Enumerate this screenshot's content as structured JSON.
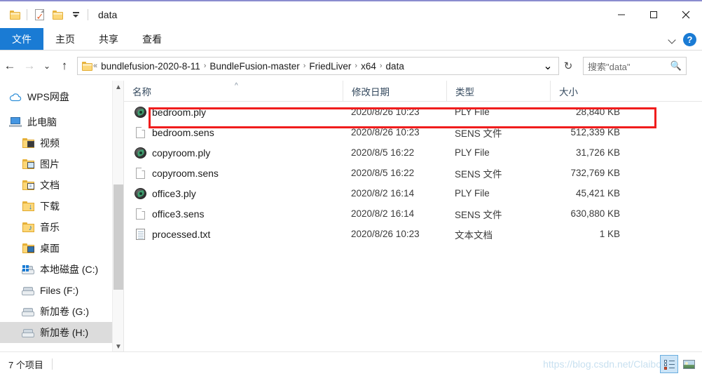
{
  "window": {
    "title": "data",
    "quick_access": [
      {
        "name": "folder-icon",
        "label": "folder"
      },
      {
        "name": "properties-icon",
        "label": "properties"
      },
      {
        "name": "new-folder-icon",
        "label": "new folder"
      },
      {
        "name": "customize-caret-icon",
        "label": "customize"
      }
    ],
    "controls": {
      "minimize": "minimize",
      "maximize": "maximize",
      "close": "close"
    }
  },
  "ribbon": {
    "tabs": [
      {
        "label": "文件",
        "active": true
      },
      {
        "label": "主页",
        "active": false
      },
      {
        "label": "共享",
        "active": false
      },
      {
        "label": "查看",
        "active": false
      }
    ],
    "expand_label": "chevron-down",
    "help_label": "?"
  },
  "addressbar": {
    "back": "←",
    "forward": "→",
    "recent": "⌄",
    "up": "↑",
    "overflow": "«",
    "crumbs": [
      "bundlefusion-2020-8-11",
      "BundleFusion-master",
      "FriedLiver",
      "x64",
      "data"
    ],
    "separator": "›",
    "dropdown": "⌄",
    "refresh": "↻"
  },
  "search": {
    "placeholder": "搜索\"data\"",
    "icon": "search-icon"
  },
  "sidebar": {
    "items": [
      {
        "label": "WPS网盘",
        "icon": "cloud-icon",
        "indent": 0,
        "selected": false
      },
      {
        "label": "此电脑",
        "icon": "this-pc-icon",
        "indent": 0,
        "selected": false
      },
      {
        "label": "视频",
        "icon": "videos-folder-icon",
        "indent": 1,
        "selected": false
      },
      {
        "label": "图片",
        "icon": "pictures-folder-icon",
        "indent": 1,
        "selected": false
      },
      {
        "label": "文档",
        "icon": "documents-folder-icon",
        "indent": 1,
        "selected": false
      },
      {
        "label": "下载",
        "icon": "downloads-folder-icon",
        "indent": 1,
        "selected": false
      },
      {
        "label": "音乐",
        "icon": "music-folder-icon",
        "indent": 1,
        "selected": false
      },
      {
        "label": "桌面",
        "icon": "desktop-folder-icon",
        "indent": 1,
        "selected": false
      },
      {
        "label": "本地磁盘 (C:)",
        "icon": "system-drive-icon",
        "indent": 1,
        "selected": false
      },
      {
        "label": "Files (F:)",
        "icon": "drive-icon",
        "indent": 1,
        "selected": false
      },
      {
        "label": "新加卷 (G:)",
        "icon": "drive-icon",
        "indent": 1,
        "selected": false
      },
      {
        "label": "新加卷 (H:)",
        "icon": "drive-icon",
        "indent": 1,
        "selected": true
      }
    ]
  },
  "filelist": {
    "columns": [
      {
        "label": "名称",
        "key": "name"
      },
      {
        "label": "修改日期",
        "key": "date"
      },
      {
        "label": "类型",
        "key": "type"
      },
      {
        "label": "大小",
        "key": "size"
      }
    ],
    "sort": {
      "column": "名称",
      "direction": "asc",
      "glyph": "^"
    },
    "rows": [
      {
        "name": "bedroom.ply",
        "date": "2020/8/26 10:23",
        "type": "PLY File",
        "size": "28,840 KB",
        "icon": "ply-file-icon",
        "highlighted": true
      },
      {
        "name": "bedroom.sens",
        "date": "2020/8/26 10:23",
        "type": "SENS 文件",
        "size": "512,339 KB",
        "icon": "generic-file-icon",
        "highlighted": false
      },
      {
        "name": "copyroom.ply",
        "date": "2020/8/5 16:22",
        "type": "PLY File",
        "size": "31,726 KB",
        "icon": "ply-file-icon",
        "highlighted": false
      },
      {
        "name": "copyroom.sens",
        "date": "2020/8/5 16:22",
        "type": "SENS 文件",
        "size": "732,769 KB",
        "icon": "generic-file-icon",
        "highlighted": false
      },
      {
        "name": "office3.ply",
        "date": "2020/8/2 16:14",
        "type": "PLY File",
        "size": "45,421 KB",
        "icon": "ply-file-icon",
        "highlighted": false
      },
      {
        "name": "office3.sens",
        "date": "2020/8/2 16:14",
        "type": "SENS 文件",
        "size": "630,880 KB",
        "icon": "generic-file-icon",
        "highlighted": false
      },
      {
        "name": "processed.txt",
        "date": "2020/8/26 10:23",
        "type": "文本文档",
        "size": "1 KB",
        "icon": "text-file-icon",
        "highlighted": false
      }
    ]
  },
  "statusbar": {
    "item_count": "7 个项目",
    "watermark": "https://blog.csdn.net/Claibo",
    "views": [
      {
        "name": "details-view",
        "active": true
      },
      {
        "name": "large-icons-view",
        "active": false
      }
    ]
  },
  "colors": {
    "accent": "#1a7bd4",
    "annotation": "#f01d1d",
    "selection": "#dcdcdc"
  }
}
